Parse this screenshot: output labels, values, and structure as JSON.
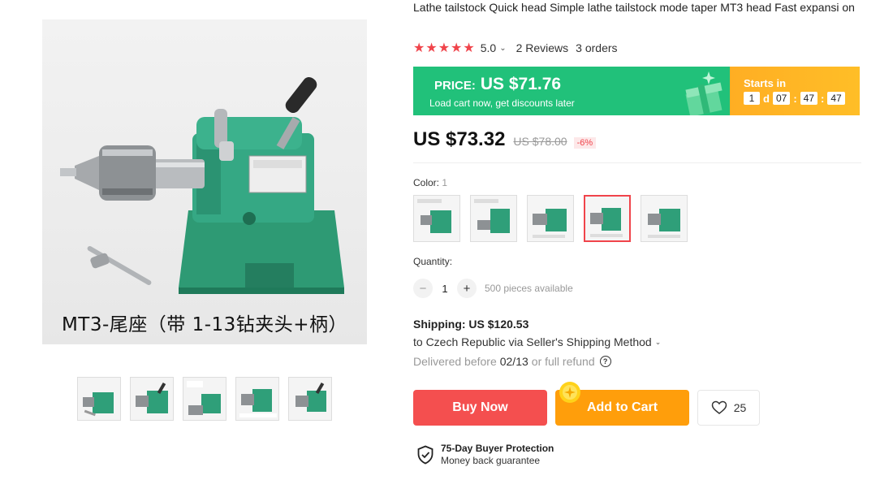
{
  "product": {
    "title": "Lathe tailstock Quick head Simple lathe tailstock mode taper MT3 head Fast expansi on",
    "main_image_caption": "MT3-尾座（带 1-13钻夹头+柄）",
    "thumbnails": [
      "thumb-1",
      "thumb-2",
      "thumb-3",
      "thumb-4",
      "thumb-5"
    ]
  },
  "rating": {
    "stars": "★★★★★",
    "value": "5.0",
    "reviews": "2 Reviews",
    "orders": "3 orders"
  },
  "promo": {
    "price_label": "PRICE:",
    "price": "US $71.76",
    "subtitle": "Load cart now, get discounts later",
    "starts_in": "Starts in",
    "days": "1",
    "days_unit": "d",
    "hours": "07",
    "minutes": "47",
    "seconds": "47",
    "colors": {
      "green": "#21c17a",
      "orange": "#ffae23"
    }
  },
  "pricing": {
    "current": "US $73.32",
    "original": "US $78.00",
    "discount": "-6%"
  },
  "color": {
    "label": "Color:",
    "value": "1",
    "selected_index": 3,
    "options": [
      "option-1",
      "option-2",
      "option-3",
      "option-4",
      "option-5"
    ]
  },
  "quantity": {
    "label": "Quantity:",
    "minus": "−",
    "value": "1",
    "plus": "+",
    "available": "500 pieces available"
  },
  "shipping": {
    "title": "Shipping: US $120.53",
    "destination": "to Czech Republic via Seller's Shipping Method",
    "delivered_prefix": "Delivered before",
    "delivered_date": "02/13",
    "delivered_suffix": "or full refund",
    "help": "?"
  },
  "actions": {
    "buy_now": "Buy Now",
    "add_to_cart": "Add to Cart",
    "wishlist_count": "25"
  },
  "protection": {
    "title": "75-Day Buyer Protection",
    "subtitle": "Money back guarantee"
  }
}
